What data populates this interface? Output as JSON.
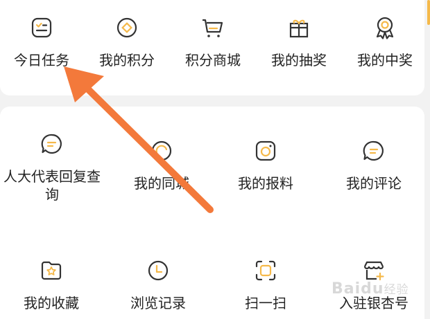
{
  "colors": {
    "accent": "#f5b94a",
    "icon_stroke": "#333333",
    "arrow": "#f3793b",
    "background": "#f2f2f2",
    "card": "#ffffff"
  },
  "top_grid": [
    {
      "label": "今日任务",
      "icon": "checklist-icon"
    },
    {
      "label": "我的积分",
      "icon": "coin-icon"
    },
    {
      "label": "积分商城",
      "icon": "shopping-cart-icon"
    },
    {
      "label": "我的抽奖",
      "icon": "gift-icon"
    },
    {
      "label": "我的中奖",
      "icon": "award-medal-icon"
    }
  ],
  "bottom_grid": [
    {
      "label": "人大代表回复查询",
      "icon": "chat-bubble-icon"
    },
    {
      "label": "我的同城",
      "icon": "location-circle-icon"
    },
    {
      "label": "我的报料",
      "icon": "camera-icon"
    },
    {
      "label": "我的评论",
      "icon": "comment-icon"
    },
    {
      "label": "我的收藏",
      "icon": "star-folder-icon"
    },
    {
      "label": "浏览记录",
      "icon": "clock-icon"
    },
    {
      "label": "扫一扫",
      "icon": "scan-icon"
    },
    {
      "label": "入驻银杏号",
      "icon": "store-add-icon"
    }
  ],
  "watermark": {
    "brand": "Baidu",
    "sub": "经验"
  }
}
